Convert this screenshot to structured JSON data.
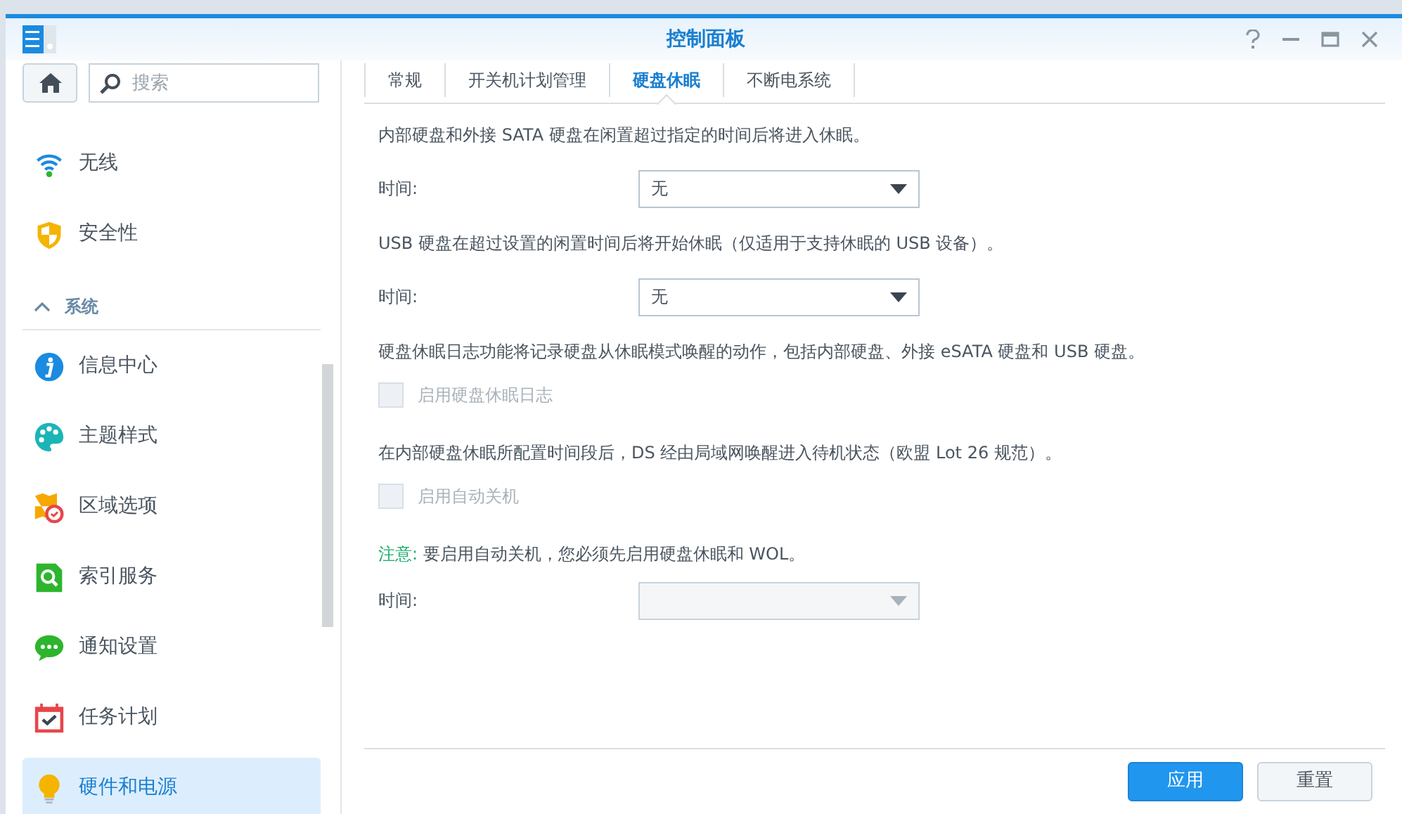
{
  "window": {
    "title": "控制面板"
  },
  "search": {
    "placeholder": "搜索"
  },
  "sidebar": {
    "items": [
      {
        "kind": "hidden-top"
      },
      {
        "label": "无线",
        "kind": "item",
        "selected": false
      },
      {
        "label": "安全性",
        "kind": "item",
        "selected": false
      },
      {
        "label": "系统",
        "kind": "section",
        "expanded": true
      },
      {
        "label": "信息中心",
        "kind": "item",
        "selected": false
      },
      {
        "label": "主题样式",
        "kind": "item",
        "selected": false
      },
      {
        "label": "区域选项",
        "kind": "item",
        "selected": false
      },
      {
        "label": "索引服务",
        "kind": "item",
        "selected": false
      },
      {
        "label": "通知设置",
        "kind": "item",
        "selected": false
      },
      {
        "label": "任务计划",
        "kind": "item",
        "selected": false
      },
      {
        "label": "硬件和电源",
        "kind": "item",
        "selected": true
      }
    ]
  },
  "tabs": [
    {
      "label": "常规",
      "selected": false
    },
    {
      "label": "开关机计划管理",
      "selected": false
    },
    {
      "label": "硬盘休眠",
      "selected": true
    },
    {
      "label": "不断电系统",
      "selected": false
    }
  ],
  "content": [
    {
      "kind": "text",
      "text": "内部硬盘和外接 SATA 硬盘在闲置超过指定的时间后将进入休眠。"
    },
    {
      "kind": "select",
      "label": "时间:",
      "value": "无",
      "disabled": false
    },
    {
      "kind": "text",
      "text": "USB 硬盘在超过设置的闲置时间后将开始休眠（仅适用于支持休眠的 USB 设备）。"
    },
    {
      "kind": "select",
      "label": "时间:",
      "value": "无",
      "disabled": false
    },
    {
      "kind": "text",
      "text": "硬盘休眠日志功能将记录硬盘从休眠模式唤醒的动作，包括内部硬盘、外接 eSATA 硬盘和 USB 硬盘。"
    },
    {
      "kind": "checkbox",
      "label": "启用硬盘休眠日志",
      "checked": false,
      "disabled": true
    },
    {
      "kind": "text",
      "text": "在内部硬盘休眠所配置时间段后，DS 经由局域网唤醒进入待机状态（欧盟 Lot 26 规范）。"
    },
    {
      "kind": "checkbox",
      "label": "启用自动关机",
      "checked": false,
      "disabled": true
    },
    {
      "kind": "note",
      "text": "**注意:** 要启用自动关机，您必须先启用硬盘休眠和 WOL。"
    },
    {
      "kind": "select",
      "label": "时间:",
      "disabled": true
    }
  ],
  "buttons": [
    {
      "label": "应用",
      "kind": "primary"
    },
    {
      "label": "重置",
      "kind": "secondary"
    }
  ]
}
